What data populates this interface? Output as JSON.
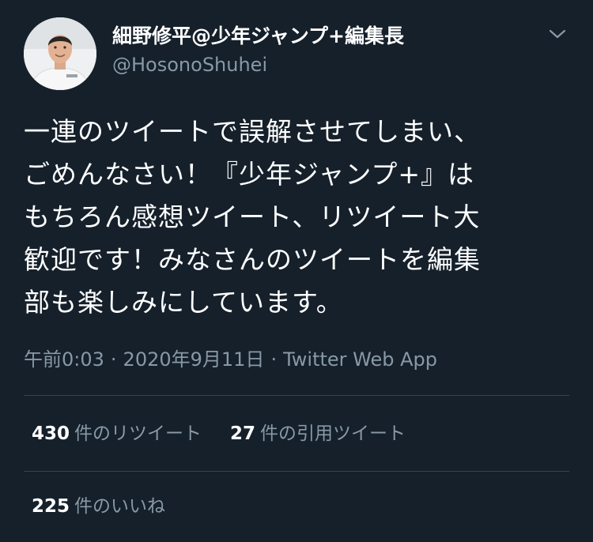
{
  "author": {
    "display_name": "細野修平@少年ジャンプ+編集長",
    "handle": "@HosonoShuhei"
  },
  "tweet": {
    "lines": [
      "一連のツイートで誤解させてしまい、",
      "ごめんなさい！『少年ジャンプ+』は",
      "もちろん感想ツイート、リツイート大",
      "歓迎です！みなさんのツイートを編集",
      "部も楽しみにしています。"
    ],
    "time": "午前0:03",
    "date": "2020年9月11日",
    "source": "Twitter Web App",
    "separator": "·"
  },
  "stats": {
    "retweets_count": "430",
    "retweets_label": "件のリツイート",
    "quotes_count": "27",
    "quotes_label": "件の引用ツイート",
    "likes_count": "225",
    "likes_label": "件のいいね"
  },
  "icons": {
    "menu": "chevron-down-icon",
    "avatar": "profile-photo"
  },
  "colors": {
    "background": "#15202b",
    "secondary_text": "#8899a6",
    "divider": "#38444d",
    "primary_text": "#ffffff"
  }
}
